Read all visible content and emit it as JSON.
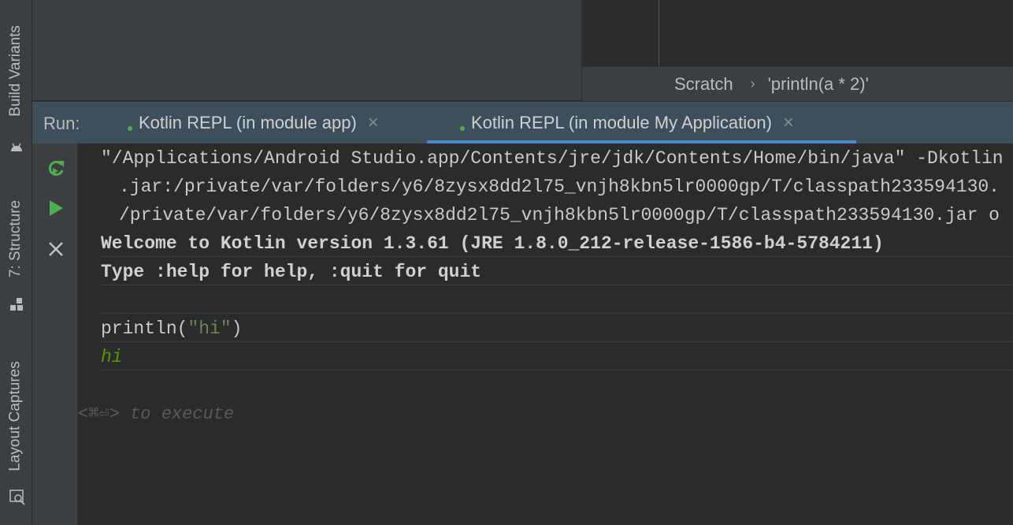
{
  "side_tabs": {
    "build_variants": "Build Variants",
    "structure": "7: Structure",
    "layout_captures": "Layout Captures"
  },
  "breadcrumb": {
    "item1": "Scratch",
    "separator": "›",
    "item2": "'println(a * 2)'"
  },
  "run": {
    "label": "Run:",
    "tabs": [
      {
        "label": "Kotlin REPL (in module app)",
        "close": "×",
        "active": false
      },
      {
        "label": "Kotlin REPL (in module My Application)",
        "close": "×",
        "active": true
      }
    ]
  },
  "console": {
    "lines": [
      "\"/Applications/Android Studio.app/Contents/jre/jdk/Contents/Home/bin/java\" -Dkotlin",
      ".jar:/private/var/folders/y6/8zysx8dd2l75_vnjh8kbn5lr0000gp/T/classpath233594130.",
      "/private/var/folders/y6/8zysx8dd2l75_vnjh8kbn5lr0000gp/T/classpath233594130.jar o",
      "Welcome to Kotlin version 1.3.61 (JRE 1.8.0_212-release-1586-b4-5784211)",
      "Type :help for help, :quit for quit"
    ],
    "input_prefix": "println(",
    "input_string": "\"hi\"",
    "input_suffix": ")",
    "output": "hi",
    "hint": "<⌘⏎> to execute"
  },
  "colors": {
    "accent": "#4a88c7",
    "run_green": "#4caf50",
    "output_green": "#4e9a06"
  }
}
